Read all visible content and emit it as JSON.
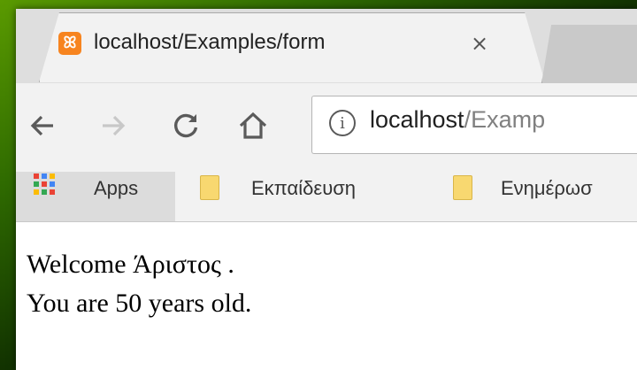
{
  "tab": {
    "title": "localhost/Examples/form",
    "close_glyph": "×",
    "favicon": "xampp-icon"
  },
  "toolbar": {
    "url_host": "localhost",
    "url_path": "/Examp"
  },
  "bookmarks": {
    "apps_label": "Apps",
    "items": [
      {
        "label": "Εκπαίδευση"
      },
      {
        "label": "Ενημέρωσ"
      }
    ]
  },
  "page": {
    "line1": "Welcome Άριστος .",
    "line2": "You are 50 years old."
  },
  "colors": {
    "favicon": "#f7841f",
    "folder": "#f8d870",
    "desktop": "#2f6b00"
  }
}
